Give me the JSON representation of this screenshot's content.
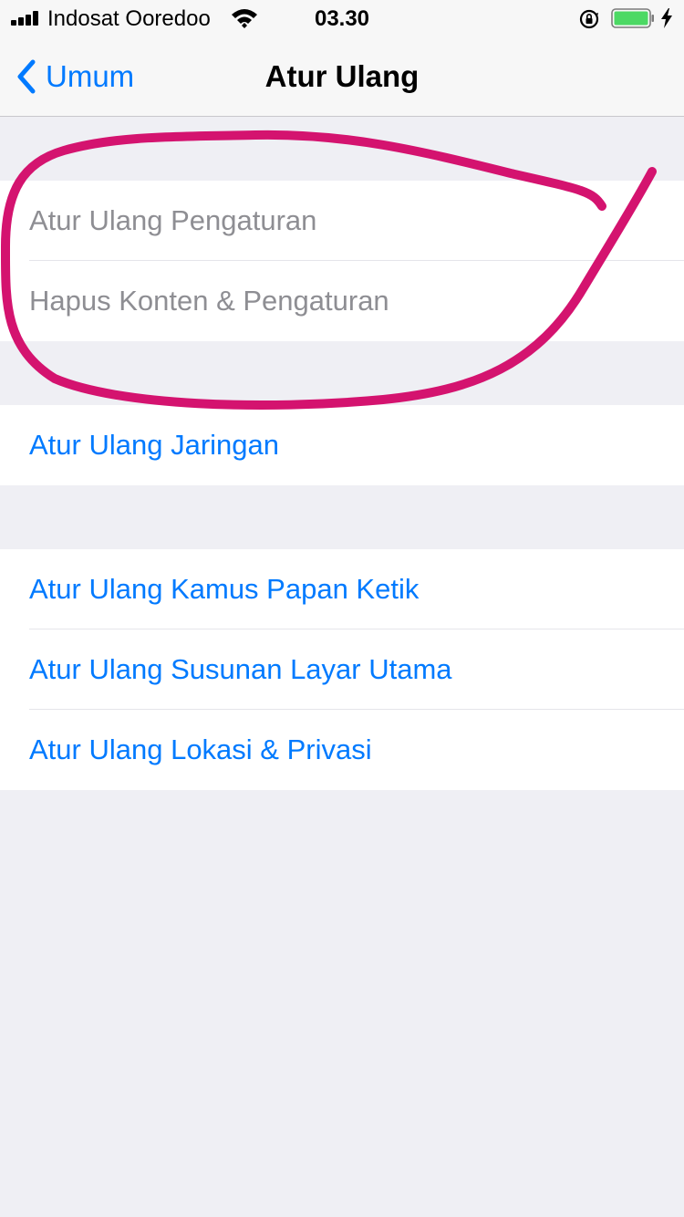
{
  "status_bar": {
    "carrier": "Indosat Ooredoo",
    "time": "03.30",
    "battery_level": 1.0
  },
  "nav": {
    "back_label": "Umum",
    "title": "Atur Ulang"
  },
  "groups": [
    {
      "items": [
        {
          "label": "Atur Ulang Pengaturan",
          "enabled": false
        },
        {
          "label": "Hapus Konten & Pengaturan",
          "enabled": false
        }
      ]
    },
    {
      "items": [
        {
          "label": "Atur Ulang Jaringan",
          "enabled": true
        }
      ]
    },
    {
      "items": [
        {
          "label": "Atur Ulang Kamus Papan Ketik",
          "enabled": true
        },
        {
          "label": "Atur Ulang Susunan Layar Utama",
          "enabled": true
        },
        {
          "label": "Atur Ulang Lokasi & Privasi",
          "enabled": true
        }
      ]
    }
  ],
  "colors": {
    "accent": "#007aff",
    "disabled_text": "#8e8e93",
    "annotation": "#d4136f",
    "battery": "#4cd964"
  },
  "icons": [
    "signal-icon",
    "wifi-icon",
    "rotation-lock-icon",
    "battery-icon",
    "charging-icon",
    "chevron-left-icon"
  ]
}
